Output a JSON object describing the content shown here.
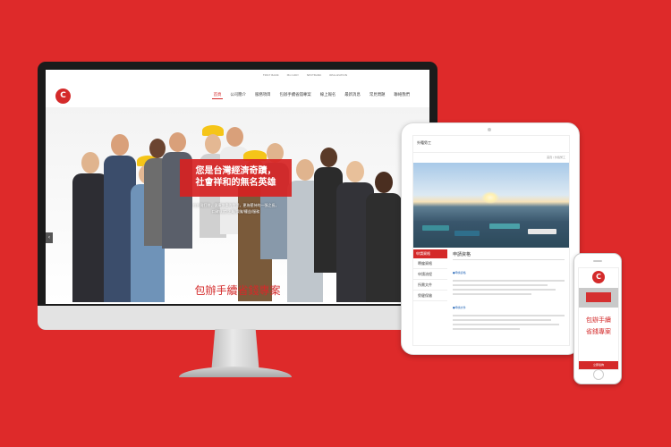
{
  "desktop": {
    "toplinks": [
      "FIRST BANK",
      "MicroPAY",
      "NEXTBANK",
      "REALIZATION"
    ],
    "logo_glyph": "C",
    "nav": [
      "首頁",
      "公司簡介",
      "服務項目",
      "包辦手續省錢專案",
      "線上報名",
      "最新消息",
      "常見問題",
      "聯絡我們"
    ],
    "hero": {
      "line1": "您是台灣經濟奇蹟，",
      "line2": "社會祥和的無名英雄",
      "sub1": "在台灣打拼，健康快樂的生活，更為堅持的一張之長，",
      "sub2": "口碑成就/企業/保險/權益/服務"
    },
    "arrow_left": "‹",
    "arrow_right": "›",
    "section_title": "包辦手續省錢專案",
    "apple_glyph": ""
  },
  "tablet": {
    "header_title": "外籍勞工",
    "breadcrumb": "首頁 / 外籍勞工",
    "sidebar_active": "申請資格",
    "sidebar_items": [
      "聘僱資格",
      "申請流程",
      "所需文件",
      "勞健保險"
    ],
    "main_title": "申請資格",
    "tag1": "●申請資格",
    "tag2": "●申請文件"
  },
  "phone": {
    "logo_glyph": "C",
    "title_line1": "包辦手續",
    "title_line2": "省錢專案",
    "footer": "立即諮詢"
  },
  "colors": {
    "brand_red": "#d42a2a",
    "background": "#de2a2a"
  }
}
